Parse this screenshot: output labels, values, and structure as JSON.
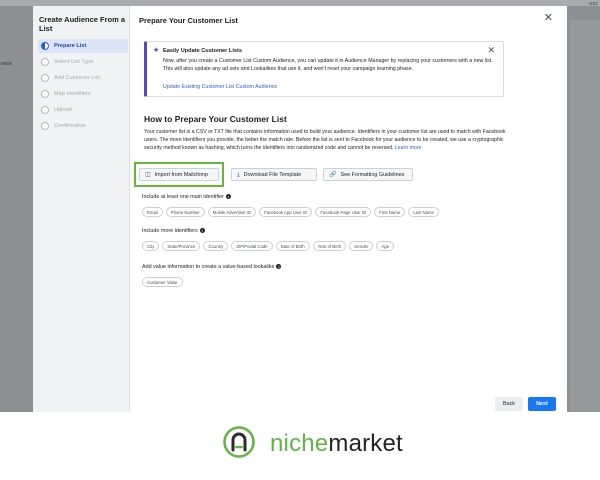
{
  "backdrop": {
    "stamp": "8:52",
    "left_label": "ence"
  },
  "sidebar": {
    "title": "Create Audience From a List",
    "steps": [
      {
        "label": "Prepare List",
        "state": "active"
      },
      {
        "label": "Select List Type",
        "state": "pending"
      },
      {
        "label": "Add Customer List",
        "state": "pending"
      },
      {
        "label": "Map Identifiers",
        "state": "pending"
      },
      {
        "label": "Upload",
        "state": "pending"
      },
      {
        "label": "Confirmation",
        "state": "pending"
      }
    ]
  },
  "modal": {
    "title": "Prepare Your Customer List",
    "close_icon": "close-icon"
  },
  "banner": {
    "icon": "star-icon",
    "title": "Easily Update Customer Lists",
    "body": "Now, after you create a Customer List Custom Audience, you can update it in Audience Manager by replacing your customers with a new list. This will also update any ad sets and Lookalikes that use it, and won't reset your campaign learning phase.",
    "link": "Update Existing Customer List Custom Audience"
  },
  "how_to": {
    "title": "How to Prepare Your Customer List",
    "description": "Your customer list is a CSV or TXT file that contains information used to build your audience. Identifiers in your customer list are used to match with Facebook users. The more identifiers you provide, the better the match rate. Before the list is sent to Facebook for your audience to be created, we use a cryptographic security method known as hashing, which turns the identifiers into randomized code and cannot be reversed. ",
    "learn_more": "Learn more"
  },
  "actions": {
    "import": {
      "label": "Import from Mailchimp",
      "icon": "import-icon"
    },
    "download": {
      "label": "Download File Template",
      "icon": "download-icon"
    },
    "guidelines": {
      "label": "See Formatting Guidelines",
      "icon": "link-icon"
    }
  },
  "identifiers": {
    "main_label": "Include at least one main identifier",
    "main": [
      "Email",
      "Phone Number",
      "Mobile Advertiser ID",
      "Facebook App User ID",
      "Facebook Page User ID",
      "First Name",
      "Last Name"
    ],
    "more_label": "Include more identifiers",
    "more": [
      "City",
      "State/Province",
      "Country",
      "ZIP/Postal Code",
      "Date of Birth",
      "Year of Birth",
      "Gender",
      "Age"
    ],
    "value_label": "Add value information to create a value-based lookalike",
    "value": [
      "Customer Value"
    ]
  },
  "footer": {
    "back": "Back",
    "next": "Next"
  },
  "brand": {
    "name_part1": "niche",
    "name_part2": "market",
    "accent_color": "#5fb642",
    "logo_icon": "padlock-n-logo"
  },
  "colors": {
    "primary": "#1877f2",
    "highlight": "#66b83a",
    "banner_accent": "#5b45c8"
  }
}
